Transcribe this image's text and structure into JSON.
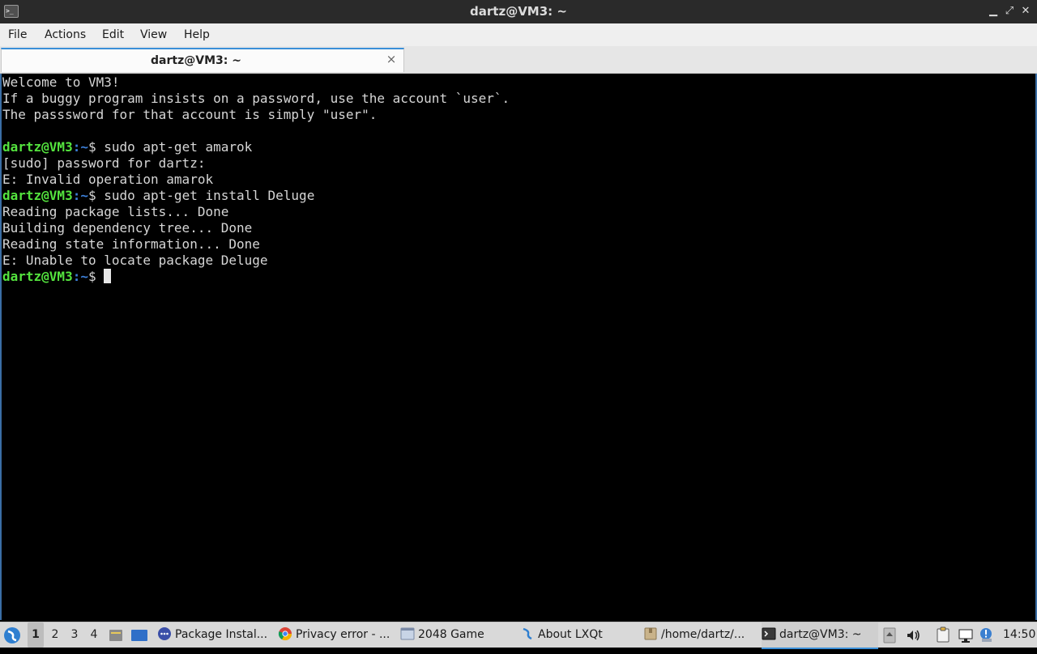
{
  "window": {
    "title": "dartz@VM3: ~",
    "controls": {
      "minimize": "▁",
      "maximize": "⤢",
      "close": "✕"
    }
  },
  "menu": [
    "File",
    "Actions",
    "Edit",
    "View",
    "Help"
  ],
  "tab": {
    "label": "dartz@VM3: ~",
    "close": "×"
  },
  "terminal": {
    "prompt_user": "dartz@VM3",
    "prompt_path": ":~",
    "prompt_symbol": "$ ",
    "lines": [
      {
        "type": "text",
        "text": "Welcome to VM3!"
      },
      {
        "type": "text",
        "text": "If a buggy program insists on a password, use the account `user`."
      },
      {
        "type": "text",
        "text": "The passsword for that account is simply \"user\"."
      },
      {
        "type": "text",
        "text": ""
      },
      {
        "type": "cmd",
        "text": "sudo apt-get amarok"
      },
      {
        "type": "text",
        "text": "[sudo] password for dartz:"
      },
      {
        "type": "text",
        "text": "E: Invalid operation amarok"
      },
      {
        "type": "cmd",
        "text": "sudo apt-get install Deluge"
      },
      {
        "type": "text",
        "text": "Reading package lists... Done"
      },
      {
        "type": "text",
        "text": "Building dependency tree... Done"
      },
      {
        "type": "text",
        "text": "Reading state information... Done"
      },
      {
        "type": "text",
        "text": "E: Unable to locate package Deluge"
      },
      {
        "type": "prompt",
        "text": ""
      }
    ]
  },
  "taskbar": {
    "desktops": [
      "1",
      "2",
      "3",
      "4"
    ],
    "active_desktop": "1",
    "tasks": [
      {
        "label": "Package Instal...",
        "icon": "package-installer-icon"
      },
      {
        "label": "Privacy error - ...",
        "icon": "chrome-icon"
      },
      {
        "label": "2048 Game",
        "icon": "window-icon"
      },
      {
        "label": "About LXQt",
        "icon": "lxqt-icon"
      },
      {
        "label": "/home/dartz/...",
        "icon": "folder-icon"
      },
      {
        "label": "dartz@VM3: ~",
        "icon": "terminal-icon"
      }
    ],
    "clock": "14:50"
  }
}
